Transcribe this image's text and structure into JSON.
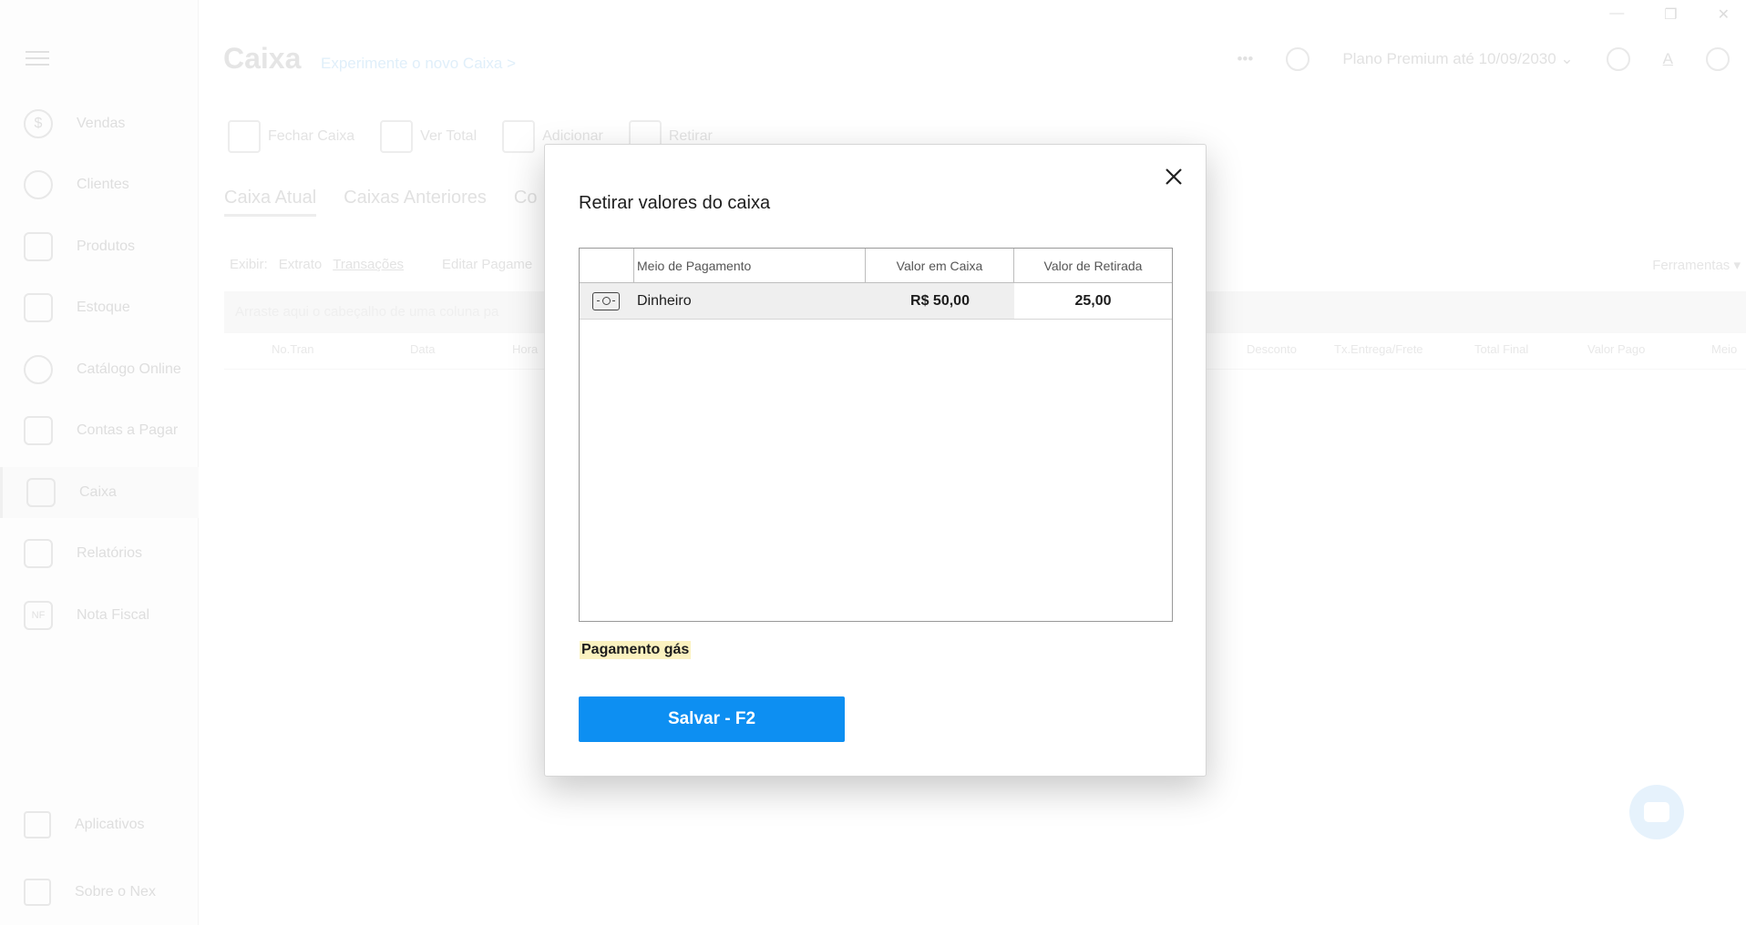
{
  "window": {
    "minimize": "—",
    "maximize": "❐",
    "close": "✕"
  },
  "sidebar": {
    "items": [
      {
        "label": "Vendas",
        "icon": "$"
      },
      {
        "label": "Clientes",
        "icon": ""
      },
      {
        "label": "Produtos",
        "icon": ""
      },
      {
        "label": "Estoque",
        "icon": ""
      },
      {
        "label": "Catálogo Online",
        "icon": ""
      },
      {
        "label": "Contas a Pagar",
        "icon": ""
      },
      {
        "label": "Caixa",
        "icon": ""
      },
      {
        "label": "Relatórios",
        "icon": ""
      },
      {
        "label": "Nota Fiscal",
        "icon": "NF"
      }
    ],
    "bottom": [
      {
        "label": "Aplicativos"
      },
      {
        "label": "Sobre o Nex"
      }
    ]
  },
  "header": {
    "title": "Caixa",
    "new_link": "Experimente o novo Caixa >",
    "more": "•••",
    "plan": "Plano Premium até 10/09/2030 ⌄",
    "user_initial": "A"
  },
  "toolbar": {
    "fechar": "Fechar Caixa",
    "ver_total": "Ver Total",
    "adicionar": "Adicionar",
    "retirar": "Retirar"
  },
  "tabs": [
    "Caixa Atual",
    "Caixas Anteriores",
    "Co"
  ],
  "filters": {
    "exibir": "Exibir:",
    "extrato": "Extrato",
    "transacoes": "Transações",
    "editar": "Editar Pagame"
  },
  "ferramentas": "Ferramentas ▾",
  "dropbar_hint": "Arraste aqui o cabeçalho de uma coluna pa",
  "columns": [
    "No.Tran",
    "Data",
    "Hora",
    "Desconto",
    "Tx.Entrega/Frete",
    "Total Final",
    "Valor Pago",
    "Meio"
  ],
  "modal": {
    "title": "Retirar valores do caixa",
    "grid": {
      "headers": [
        "Meio de Pagamento",
        "Valor em Caixa",
        "Valor de Retirada"
      ],
      "rows": [
        {
          "icon": "money-icon",
          "meio": "Dinheiro",
          "valor_caixa": "R$ 50,00",
          "valor_retirada": "25,00"
        }
      ]
    },
    "note": "Pagamento gás",
    "save_label": "Salvar - F2"
  },
  "colors": {
    "accent": "#0d8ff2",
    "note_highlight": "#fbf2c0"
  }
}
